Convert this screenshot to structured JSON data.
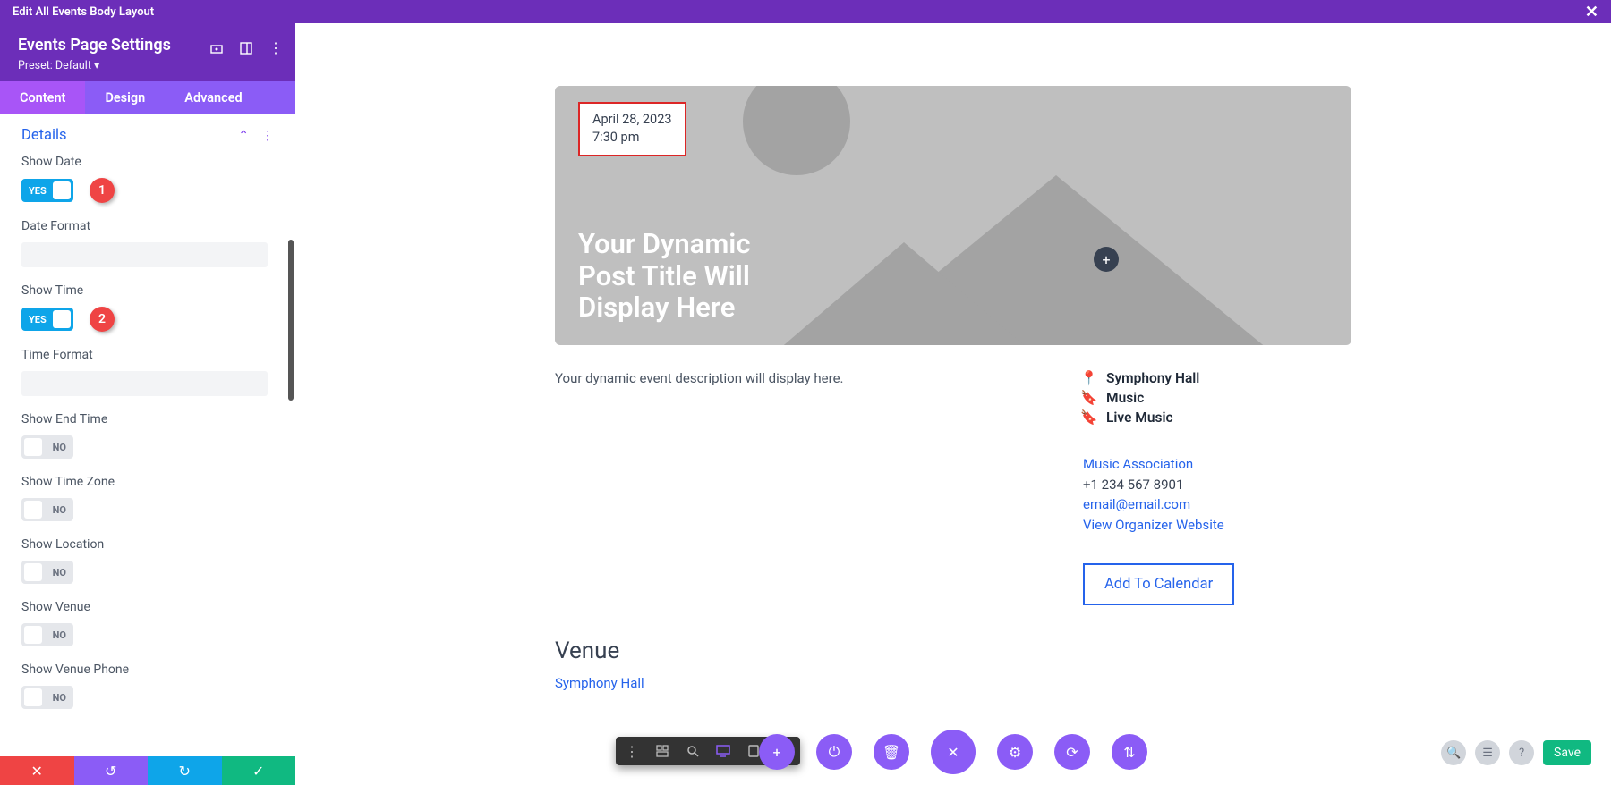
{
  "topBar": {
    "title": "Edit All Events Body Layout"
  },
  "sidebar": {
    "title": "Events Page Settings",
    "preset": "Preset: Default ▾",
    "tabs": {
      "content": "Content",
      "design": "Design",
      "advanced": "Advanced"
    },
    "section": "Details",
    "fields": {
      "showDate": "Show Date",
      "dateFormat": "Date Format",
      "showTime": "Show Time",
      "timeFormat": "Time Format",
      "showEndTime": "Show End Time",
      "showTimeZone": "Show Time Zone",
      "showLocation": "Show Location",
      "showVenue": "Show Venue",
      "showVenuePhone": "Show Venue Phone"
    },
    "toggle": {
      "yes": "YES",
      "no": "NO"
    },
    "badges": {
      "one": "1",
      "two": "2"
    }
  },
  "preview": {
    "date": "April 28, 2023",
    "time": "7:30 pm",
    "title1": "Your Dynamic",
    "title2": "Post Title Will",
    "title3": "Display Here",
    "description": "Your dynamic event description will display here.",
    "venue": "Symphony Hall",
    "cat1": "Music",
    "cat2": "Live Music",
    "orgName": "Music Association",
    "orgPhone": "+1 234 567 8901",
    "orgEmail": "email@email.com",
    "orgSite": "View Organizer Website",
    "calendarBtn": "Add To Calendar",
    "venueHeading": "Venue",
    "venueName": "Symphony Hall"
  },
  "saveBtn": "Save"
}
